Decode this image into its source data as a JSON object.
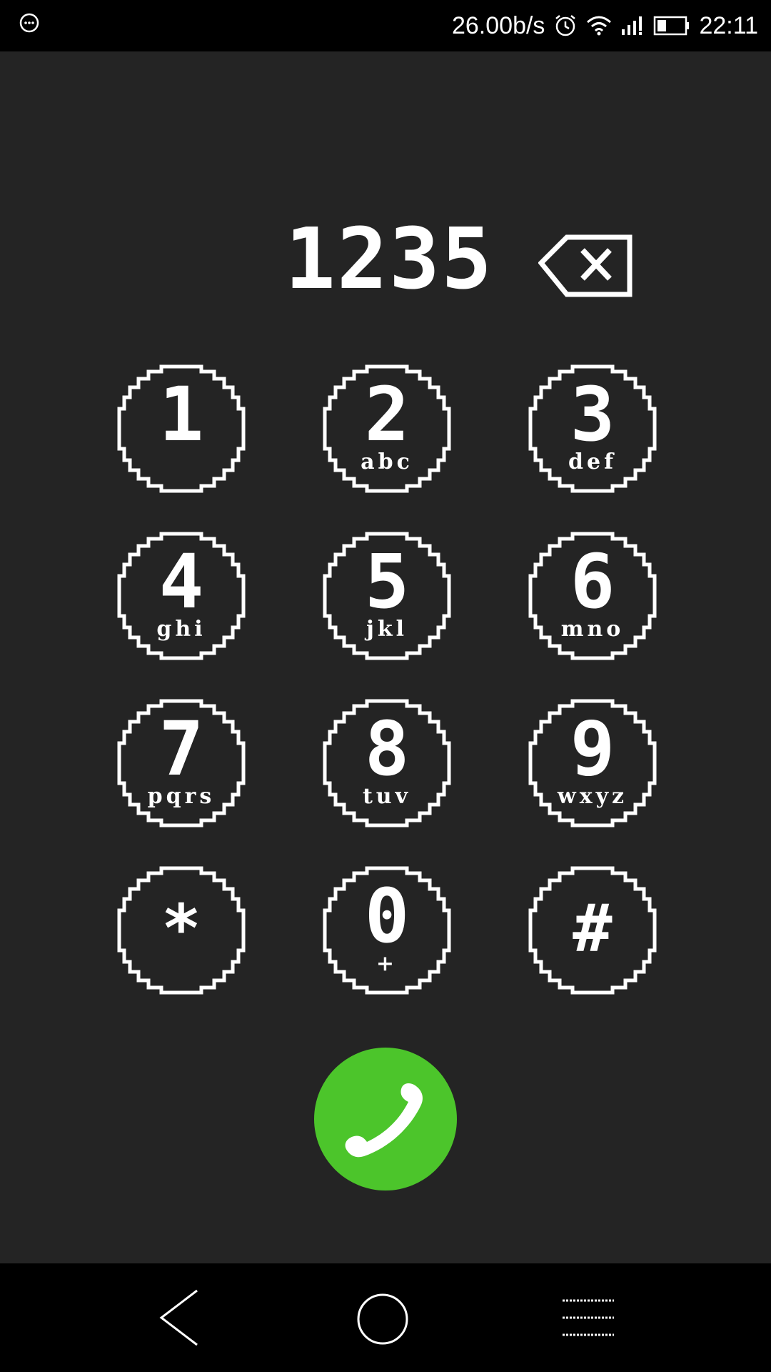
{
  "status_bar": {
    "network_speed": "26.00b/s",
    "time": "22:11",
    "icons": [
      "message-icon",
      "alarm-icon",
      "wifi-icon",
      "signal-icon",
      "battery-icon"
    ]
  },
  "dialer": {
    "number": "1235",
    "keys": [
      {
        "digit": "1",
        "letters": ""
      },
      {
        "digit": "2",
        "letters": "abc"
      },
      {
        "digit": "3",
        "letters": "def"
      },
      {
        "digit": "4",
        "letters": "ghi"
      },
      {
        "digit": "5",
        "letters": "jkl"
      },
      {
        "digit": "6",
        "letters": "mno"
      },
      {
        "digit": "7",
        "letters": "pqrs"
      },
      {
        "digit": "8",
        "letters": "tuv"
      },
      {
        "digit": "9",
        "letters": "wxyz"
      },
      {
        "digit": "*",
        "letters": ""
      },
      {
        "digit": "0",
        "letters": "+"
      },
      {
        "digit": "#",
        "letters": ""
      }
    ],
    "call_icon": "phone-icon",
    "backspace_icon": "backspace-icon"
  },
  "colors": {
    "background": "#242424",
    "bars": "#000000",
    "call_green": "#4cc52b",
    "foreground": "#ffffff"
  },
  "nav_bar": {
    "icons": [
      "back-icon",
      "home-icon",
      "menu-icon"
    ]
  }
}
